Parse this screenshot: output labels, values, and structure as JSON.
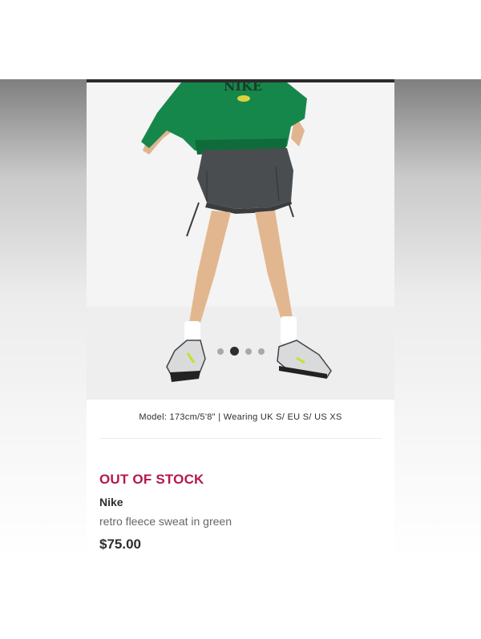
{
  "carousel": {
    "slide_count": 4,
    "active_index": 1
  },
  "product": {
    "model_info": "Model: 173cm/5'8\" | Wearing UK S/ EU S/ US XS",
    "stock_status": "OUT OF STOCK",
    "brand": "Nike",
    "name": "retro fleece sweat in green",
    "price": "$75.00"
  },
  "colors": {
    "stock_status": "#b5174f",
    "sweatshirt": "#16874a",
    "skirt": "#4a4d4f",
    "text": "#2d2d2d"
  },
  "icons": {
    "carousel_dot": "circle"
  }
}
